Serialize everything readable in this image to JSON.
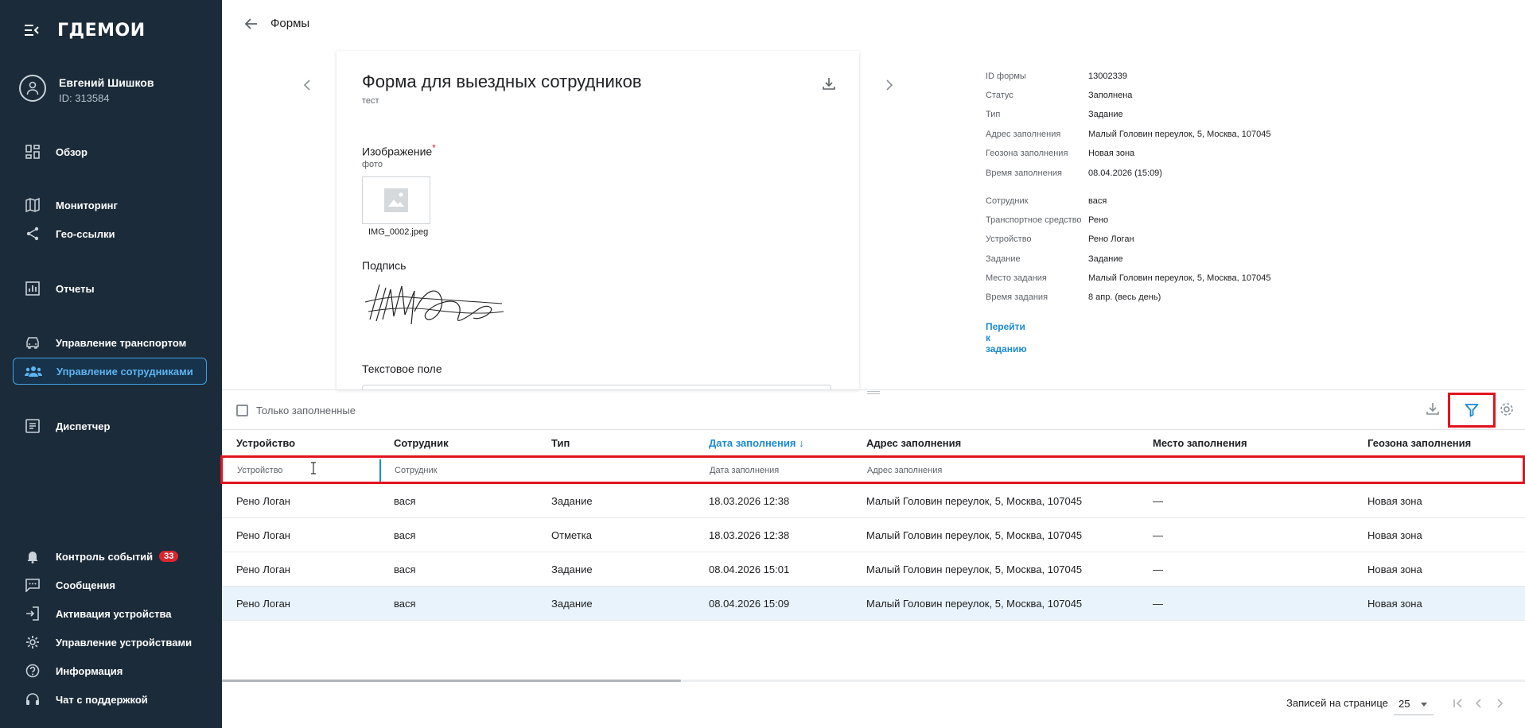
{
  "brand": {
    "logo_text": "ГДЕМОИ"
  },
  "user": {
    "name": "Евгений Шишков",
    "id": "ID: 313584"
  },
  "sidebar": {
    "items": [
      {
        "label": "Обзор",
        "icon": "dashboard-icon"
      },
      {
        "label": "Мониторинг",
        "icon": "map-icon"
      },
      {
        "label": "Гео-ссылки",
        "icon": "share-icon"
      },
      {
        "label": "Отчеты",
        "icon": "bar-chart-icon"
      },
      {
        "label": "Управление транспортом",
        "icon": "car-icon"
      },
      {
        "label": "Управление сотрудниками",
        "icon": "people-icon",
        "active": true
      },
      {
        "label": "Диспетчер",
        "icon": "dispatcher-icon"
      }
    ],
    "bottom_items": [
      {
        "label": "Контроль событий",
        "icon": "bell-icon",
        "badge": "33"
      },
      {
        "label": "Сообщения",
        "icon": "chat-icon"
      },
      {
        "label": "Активация устройства",
        "icon": "login-icon"
      },
      {
        "label": "Управление устройствами",
        "icon": "gear-icon"
      },
      {
        "label": "Информация",
        "icon": "help-icon"
      },
      {
        "label": "Чат с поддержкой",
        "icon": "headset-icon"
      }
    ]
  },
  "header": {
    "title": "Формы"
  },
  "form": {
    "title": "Форма для выездных сотрудников",
    "subtitle": "тест",
    "image_label": "Изображение",
    "image_required_mark": "*",
    "image_hint": "фото",
    "image_file": "IMG_0002.jpeg",
    "signature_label": "Подпись",
    "text_field_label": "Текстовое поле"
  },
  "details": {
    "rows": [
      {
        "key": "ID формы",
        "value": "13002339"
      },
      {
        "key": "Статус",
        "value": "Заполнена"
      },
      {
        "key": "Тип",
        "value": "Задание"
      },
      {
        "key": "Адрес заполнения",
        "value": "Малый Головин переулок, 5, Москва, 107045"
      },
      {
        "key": "Геозона заполнения",
        "value": "Новая зона"
      },
      {
        "key": "Время заполнения",
        "value": "08.04.2026 (15:09)"
      },
      {
        "key": "Сотрудник",
        "value": "вася"
      },
      {
        "key": "Транспортное средство",
        "value": "Рено"
      },
      {
        "key": "Устройство",
        "value": "Рено Логан"
      },
      {
        "key": "Задание",
        "value": "Задание"
      },
      {
        "key": "Место задания",
        "value": "Малый Головин переулок, 5, Москва, 107045"
      },
      {
        "key": "Время задания",
        "value": "8 апр. (весь день)"
      }
    ],
    "link": "Перейти к заданию"
  },
  "table": {
    "only_filled_label": "Только заполненные",
    "columns": [
      "Устройство",
      "Сотрудник",
      "Тип",
      "Дата заполнения ↓",
      "Адрес заполнения",
      "Место заполнения",
      "Геозона заполнения"
    ],
    "filters": {
      "device": "Устройство",
      "employee": "Сотрудник",
      "date": "Дата заполнения",
      "address": "Адрес заполнения"
    },
    "rows": [
      [
        "Рено Логан",
        "вася",
        "Задание",
        "18.03.2026 12:38",
        "Малый Головин переулок, 5, Москва, 107045",
        "—",
        "Новая зона"
      ],
      [
        "Рено Логан",
        "вася",
        "Отметка",
        "18.03.2026 12:38",
        "Малый Головин переулок, 5, Москва, 107045",
        "—",
        "Новая зона"
      ],
      [
        "Рено Логан",
        "вася",
        "Задание",
        "08.04.2026 15:01",
        "Малый Головин переулок, 5, Москва, 107045",
        "—",
        "Новая зона"
      ],
      [
        "Рено Логан",
        "вася",
        "Задание",
        "08.04.2026 15:09",
        "Малый Головин переулок, 5, Москва, 107045",
        "—",
        "Новая зона"
      ]
    ]
  },
  "footer": {
    "per_page_label": "Записей на странице",
    "per_page_value": "25"
  },
  "colors": {
    "sidebar_bg": "#1b2b39",
    "accent": "#1a8ad6",
    "highlight": "#e2141e",
    "badge": "#d9262e"
  }
}
